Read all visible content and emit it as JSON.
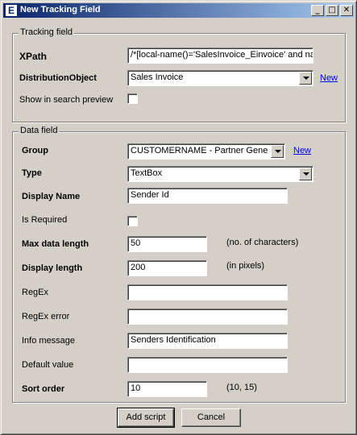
{
  "window": {
    "icon_letter": "E",
    "title": "New Tracking Field",
    "minimize_glyph": "_",
    "maximize_glyph": "□",
    "close_glyph": "✕"
  },
  "tracking": {
    "group_title": "Tracking field",
    "xpath_label": "XPath",
    "xpath_value": "/*[local-name()='SalesInvoice_Einvoice' and nam",
    "distribution_label": "DistributionObject",
    "distribution_value": "Sales Invoice",
    "new_link": "New",
    "search_preview_label": "Show in search preview",
    "search_preview_checked": false
  },
  "data_field": {
    "group_title": "Data field",
    "group_label": "Group",
    "group_value": "CUSTOMERNAME - Partner General",
    "new_link": "New",
    "type_label": "Type",
    "type_value": "TextBox",
    "display_name_label": "Display Name",
    "display_name_value": "Sender Id",
    "is_required_label": "Is Required",
    "is_required_checked": false,
    "max_length_label": "Max data length",
    "max_length_value": "50",
    "max_length_hint": "(no. of characters)",
    "display_length_label": "Display length",
    "display_length_value": "200",
    "display_length_hint": "(in pixels)",
    "regex_label": "RegEx",
    "regex_value": "",
    "regex_error_label": "RegEx error",
    "regex_error_value": "",
    "info_message_label": "Info message",
    "info_message_value": "Senders Identification",
    "default_value_label": "Default value",
    "default_value_value": "",
    "sort_order_label": "Sort order",
    "sort_order_value": "10",
    "sort_order_hint": "(10, 15)"
  },
  "buttons": {
    "add_script": "Add script",
    "cancel": "Cancel"
  },
  "colors": {
    "face": "#d4d0c8",
    "title_start": "#0a246a",
    "title_end": "#a6caf0",
    "link": "#0000ff"
  }
}
